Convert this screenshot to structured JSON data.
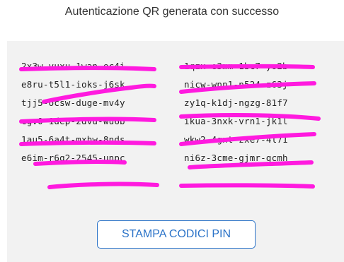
{
  "title": "Autenticazione QR generata con successo",
  "codes": [
    {
      "left": "2x3w-vuxu-1wan-ec4i",
      "right": "1qzx-e3mm-1bc7-yo2b"
    },
    {
      "left": "e8ru-t5l1-ioks-j6sk",
      "right": "nicw-wnn1-n524-z63j"
    },
    {
      "left": "tjj5-ocsw-duge-mv4y",
      "right": "zy1q-k1dj-ngzg-81f7"
    },
    {
      "left": "cgv0-1dep-2dvu-wu6b",
      "right": "ikua-3nxk-vrn1-jk1l"
    },
    {
      "left": "1au5-6a4t-mxhw-8nds",
      "right": "wkw2-4gnt-zxe7-4l71"
    },
    {
      "left": "e6im-r6g2-2545-unpc",
      "right": "ni6z-3cme-gjmr-gcmh"
    }
  ],
  "print_button_label": "STAMPA CODICI PIN",
  "colors": {
    "accent": "#2b73c8",
    "redaction": "#ff1adf",
    "panel_bg": "#f2f2f2"
  }
}
